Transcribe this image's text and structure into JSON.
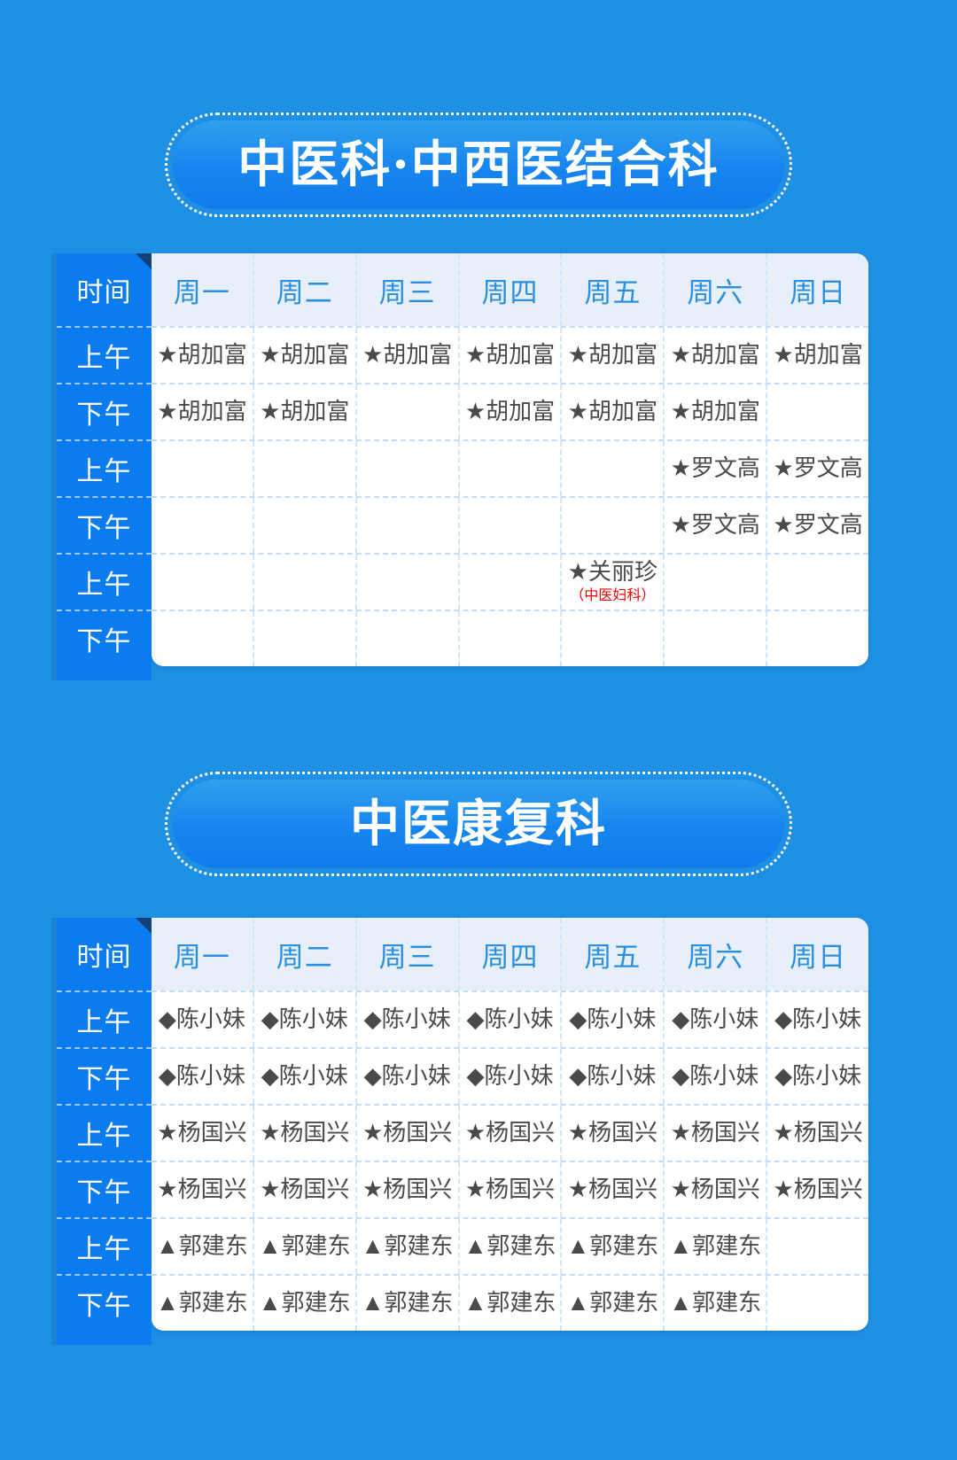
{
  "page": {
    "background_color": "#1e90e4",
    "accent_blue": "#0b7bf0",
    "header_text_color": "#2b8fe0",
    "cell_text_color": "#4a4a4a",
    "note_color": "#ff0000"
  },
  "sections": [
    {
      "title": "中医科·中西医结合科",
      "table": {
        "time_header": "时间",
        "day_headers": [
          "周一",
          "周二",
          "周三",
          "周四",
          "周五",
          "周六",
          "周日"
        ],
        "rows": [
          {
            "time": "上午",
            "cells": [
              {
                "text": "★胡加富"
              },
              {
                "text": "★胡加富"
              },
              {
                "text": "★胡加富"
              },
              {
                "text": "★胡加富"
              },
              {
                "text": "★胡加富"
              },
              {
                "text": "★胡加富"
              },
              {
                "text": "★胡加富"
              }
            ]
          },
          {
            "time": "下午",
            "cells": [
              {
                "text": "★胡加富"
              },
              {
                "text": "★胡加富"
              },
              {
                "text": ""
              },
              {
                "text": "★胡加富"
              },
              {
                "text": "★胡加富"
              },
              {
                "text": "★胡加富"
              },
              {
                "text": ""
              }
            ]
          },
          {
            "time": "上午",
            "cells": [
              {
                "text": ""
              },
              {
                "text": ""
              },
              {
                "text": ""
              },
              {
                "text": ""
              },
              {
                "text": ""
              },
              {
                "text": "★罗文高"
              },
              {
                "text": "★罗文高"
              }
            ]
          },
          {
            "time": "下午",
            "cells": [
              {
                "text": ""
              },
              {
                "text": ""
              },
              {
                "text": ""
              },
              {
                "text": ""
              },
              {
                "text": ""
              },
              {
                "text": "★罗文高"
              },
              {
                "text": "★罗文高"
              }
            ]
          },
          {
            "time": "上午",
            "cells": [
              {
                "text": ""
              },
              {
                "text": ""
              },
              {
                "text": ""
              },
              {
                "text": ""
              },
              {
                "text": "★关丽珍",
                "note": "（中医妇科）"
              },
              {
                "text": ""
              },
              {
                "text": ""
              }
            ]
          },
          {
            "time": "下午",
            "cells": [
              {
                "text": ""
              },
              {
                "text": ""
              },
              {
                "text": ""
              },
              {
                "text": ""
              },
              {
                "text": ""
              },
              {
                "text": ""
              },
              {
                "text": ""
              }
            ]
          }
        ]
      }
    },
    {
      "title": "中医康复科",
      "table": {
        "time_header": "时间",
        "day_headers": [
          "周一",
          "周二",
          "周三",
          "周四",
          "周五",
          "周六",
          "周日"
        ],
        "rows": [
          {
            "time": "上午",
            "cells": [
              {
                "text": "◆陈小妹"
              },
              {
                "text": "◆陈小妹"
              },
              {
                "text": "◆陈小妹"
              },
              {
                "text": "◆陈小妹"
              },
              {
                "text": "◆陈小妹"
              },
              {
                "text": "◆陈小妹"
              },
              {
                "text": "◆陈小妹"
              }
            ]
          },
          {
            "time": "下午",
            "cells": [
              {
                "text": "◆陈小妹"
              },
              {
                "text": "◆陈小妹"
              },
              {
                "text": "◆陈小妹"
              },
              {
                "text": "◆陈小妹"
              },
              {
                "text": "◆陈小妹"
              },
              {
                "text": "◆陈小妹"
              },
              {
                "text": "◆陈小妹"
              }
            ]
          },
          {
            "time": "上午",
            "cells": [
              {
                "text": "★杨国兴"
              },
              {
                "text": "★杨国兴"
              },
              {
                "text": "★杨国兴"
              },
              {
                "text": "★杨国兴"
              },
              {
                "text": "★杨国兴"
              },
              {
                "text": "★杨国兴"
              },
              {
                "text": "★杨国兴"
              }
            ]
          },
          {
            "time": "下午",
            "cells": [
              {
                "text": "★杨国兴"
              },
              {
                "text": "★杨国兴"
              },
              {
                "text": "★杨国兴"
              },
              {
                "text": "★杨国兴"
              },
              {
                "text": "★杨国兴"
              },
              {
                "text": "★杨国兴"
              },
              {
                "text": "★杨国兴"
              }
            ]
          },
          {
            "time": "上午",
            "cells": [
              {
                "text": "▲郭建东"
              },
              {
                "text": "▲郭建东"
              },
              {
                "text": "▲郭建东"
              },
              {
                "text": "▲郭建东"
              },
              {
                "text": "▲郭建东"
              },
              {
                "text": "▲郭建东"
              },
              {
                "text": ""
              }
            ]
          },
          {
            "time": "下午",
            "cells": [
              {
                "text": "▲郭建东"
              },
              {
                "text": "▲郭建东"
              },
              {
                "text": "▲郭建东"
              },
              {
                "text": "▲郭建东"
              },
              {
                "text": "▲郭建东"
              },
              {
                "text": "▲郭建东"
              },
              {
                "text": ""
              }
            ]
          }
        ]
      }
    }
  ]
}
